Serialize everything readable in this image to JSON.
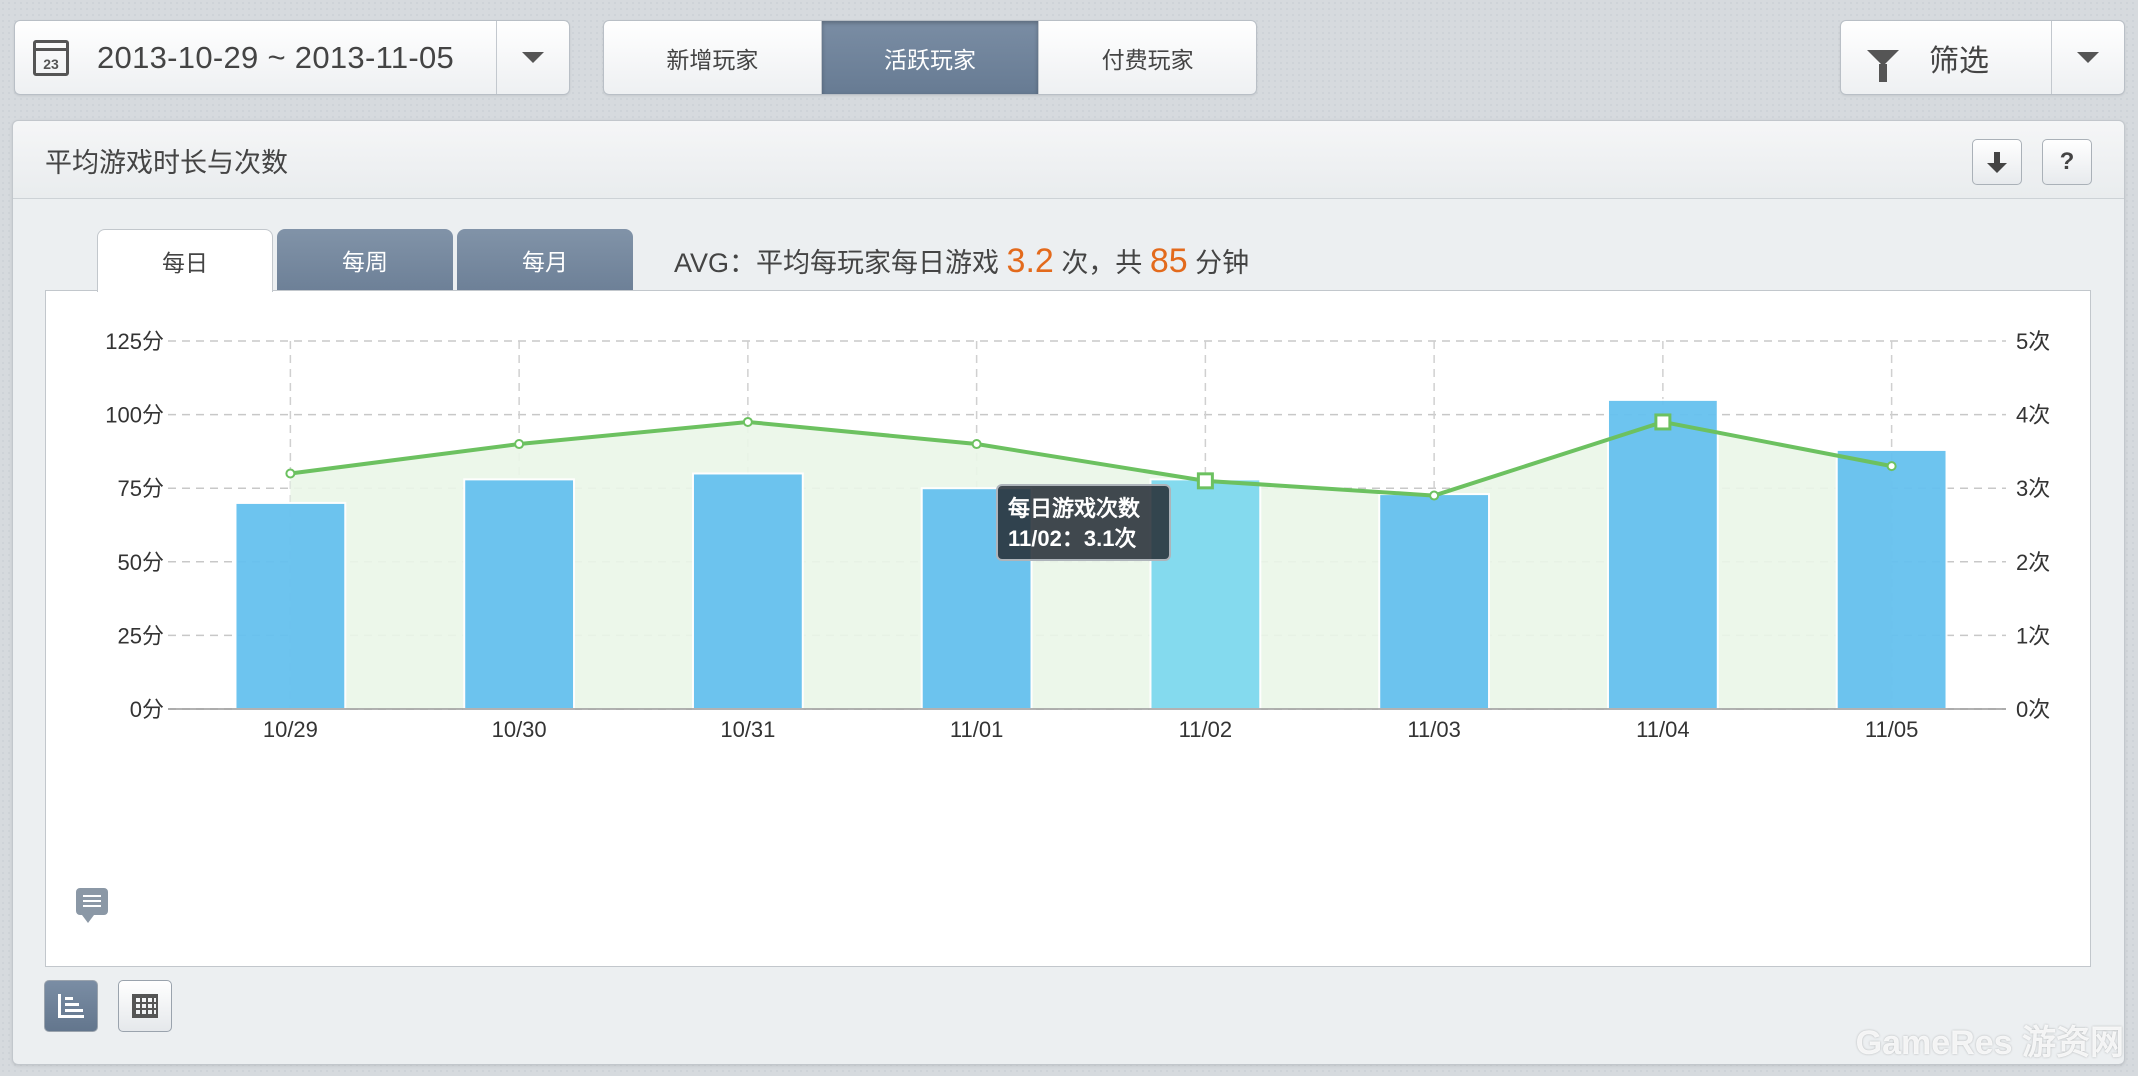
{
  "date_range": {
    "icon": "calendar-icon",
    "calendar_day": "23",
    "value": "2013-10-29 ~ 2013-11-05"
  },
  "player_tabs": [
    {
      "label": "新增玩家",
      "active": false
    },
    {
      "label": "活跃玩家",
      "active": true
    },
    {
      "label": "付费玩家",
      "active": false
    }
  ],
  "filter": {
    "label": "筛选",
    "icon": "funnel-icon"
  },
  "panel": {
    "title": "平均游戏时长与次数",
    "download_icon": "download-icon",
    "help_label": "?"
  },
  "period_tabs": [
    {
      "label": "每日",
      "active": true
    },
    {
      "label": "每周",
      "active": false
    },
    {
      "label": "每月",
      "active": false
    }
  ],
  "avg": {
    "prefix": "AVG：平均每玩家每日游戏",
    "times": "3.2",
    "times_unit": "次，共",
    "minutes": "85",
    "minutes_unit": "分钟"
  },
  "tooltip": {
    "title": "每日游戏次数",
    "value": "11/02：3.1次"
  },
  "colors": {
    "bar": "#66c1ef",
    "bar_highlight": "#7fd9ef",
    "line": "#6cc160",
    "area": "#eaf6e8",
    "accent": "#e36a1c"
  },
  "chart_data": {
    "type": "bar",
    "categories": [
      "10/29",
      "10/30",
      "10/31",
      "11/01",
      "11/02",
      "11/03",
      "11/04",
      "11/05"
    ],
    "series": [
      {
        "type": "bar",
        "axis": "left",
        "values": [
          70,
          78,
          80,
          75,
          78,
          73,
          105,
          88
        ]
      },
      {
        "type": "line",
        "axis": "right",
        "name": "每日游戏次数",
        "values": [
          3.2,
          3.6,
          3.9,
          3.6,
          3.1,
          2.9,
          3.9,
          3.3
        ]
      }
    ],
    "y_left": {
      "ticks": [
        "0分",
        "25分",
        "50分",
        "75分",
        "100分",
        "125分"
      ],
      "ylim": [
        0,
        125
      ]
    },
    "y_right": {
      "ticks": [
        "0次",
        "1次",
        "2次",
        "3次",
        "4次",
        "5次"
      ],
      "ylim": [
        0,
        5
      ]
    },
    "highlighted_category": "11/02",
    "grid": true
  },
  "view_toggle": {
    "bar_icon": "bar-chart-icon",
    "table_icon": "table-icon"
  },
  "watermark": "GameRes 游资网"
}
